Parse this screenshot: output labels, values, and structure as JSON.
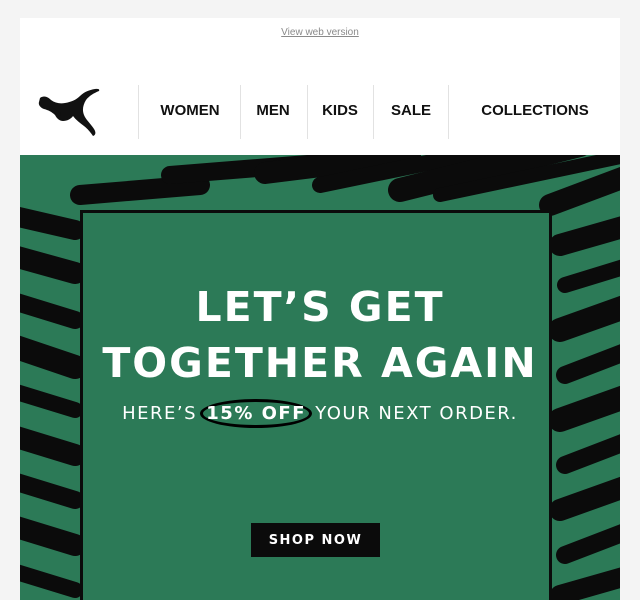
{
  "topbar": {
    "web_version_label": "View web version"
  },
  "brand": {
    "logo_icon": "puma-cat-logo-icon"
  },
  "nav": {
    "items": [
      {
        "label": "WOMEN"
      },
      {
        "label": "MEN"
      },
      {
        "label": "KIDS"
      },
      {
        "label": "SALE"
      },
      {
        "label": "COLLECTIONS"
      }
    ]
  },
  "hero": {
    "headline_line1": "LET’S GET",
    "headline_line2": "TOGETHER AGAIN",
    "sub_prefix": "HERE’S",
    "sub_offer": "15% OFF",
    "sub_suffix": "YOUR NEXT ORDER.",
    "cta_label": "SHOP NOW",
    "colors": {
      "background": "#2c7a57",
      "ink": "#0b0b0b",
      "text": "#ffffff"
    }
  }
}
